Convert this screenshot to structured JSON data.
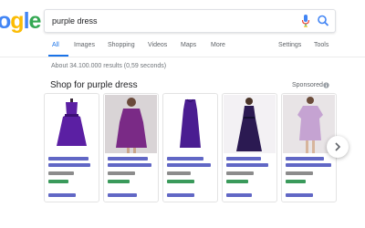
{
  "logo": {
    "text": "ogle",
    "colors": [
      "#4285f4",
      "#fbbc05",
      "#4285f4",
      "#34a853",
      "#ea4335"
    ]
  },
  "search": {
    "query": "purple dress",
    "mic_icon": "mic-icon",
    "search_icon": "search-icon"
  },
  "tabs": {
    "items": [
      {
        "label": "All",
        "active": true
      },
      {
        "label": "Images"
      },
      {
        "label": "Shopping"
      },
      {
        "label": "Videos"
      },
      {
        "label": "Maps"
      },
      {
        "label": "More"
      }
    ],
    "settings": "Settings",
    "tools": "Tools",
    "accent": "#1a73e8"
  },
  "results": {
    "stats": "About 34.100.000 results (0,59 seconds)"
  },
  "shopping": {
    "title": "Shop for purple dress",
    "sponsored": "Sponsored",
    "info_icon": "info-icon",
    "next_icon": "chevron-right-icon",
    "products": [
      {
        "image": "purple-dress-sleeveless"
      },
      {
        "image": "purple-dress-model"
      },
      {
        "image": "purple-dress-shift"
      },
      {
        "image": "purple-dress-gown"
      },
      {
        "image": "lilac-dress-model"
      }
    ]
  }
}
